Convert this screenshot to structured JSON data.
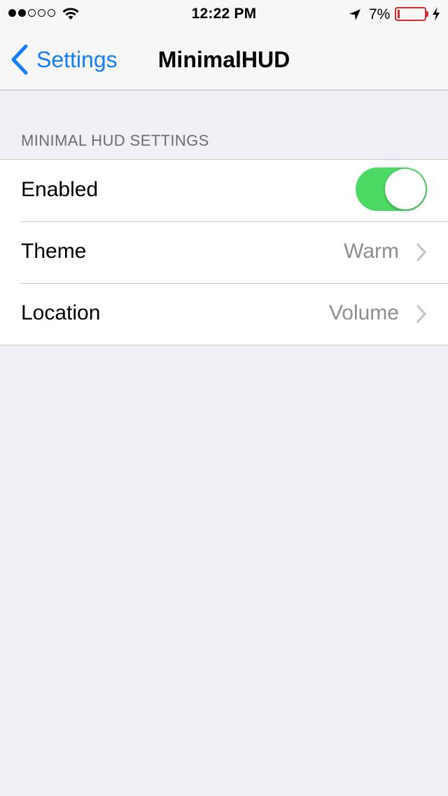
{
  "status_bar": {
    "signal_bars_filled": 2,
    "signal_bars_total": 5,
    "time": "12:22 PM",
    "battery_percent": "7%",
    "battery_level": 0.07,
    "battery_color": "#d32d2d",
    "icons": [
      "wifi-icon",
      "location-arrow-icon",
      "battery-icon",
      "charging-bolt-icon"
    ]
  },
  "nav": {
    "back_label": "Settings",
    "title": "MinimalHUD",
    "accent_color": "#147efb"
  },
  "section": {
    "header": "MINIMAL HUD SETTINGS",
    "rows": [
      {
        "label": "Enabled",
        "type": "toggle",
        "on": true,
        "toggle_color": "#4cd964"
      },
      {
        "label": "Theme",
        "type": "disclosure",
        "value": "Warm"
      },
      {
        "label": "Location",
        "type": "disclosure",
        "value": "Volume"
      }
    ]
  }
}
